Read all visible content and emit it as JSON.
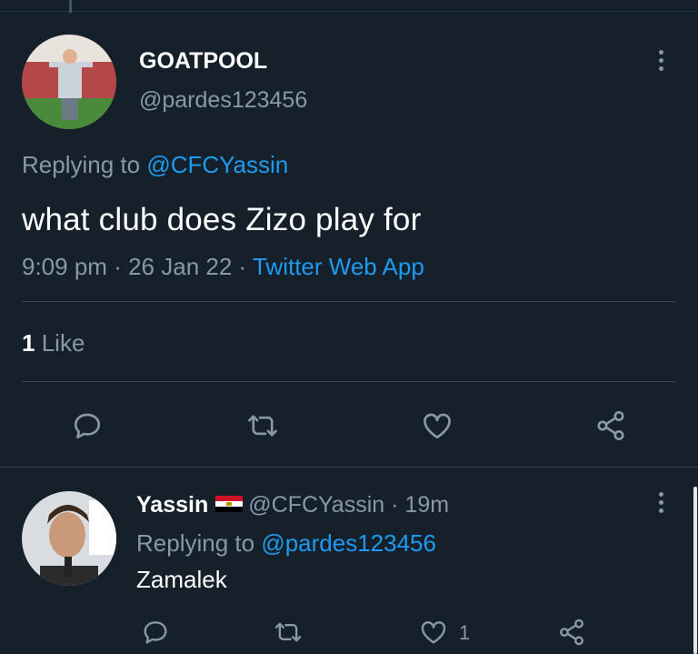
{
  "main_tweet": {
    "display_name": "GOATPOOL",
    "handle": "@pardes123456",
    "replying_prefix": "Replying to",
    "replying_to": "@CFCYassin",
    "text": "what club does Zizo play for",
    "time": "9:09 pm",
    "date": "26 Jan 22",
    "source": "Twitter Web App",
    "likes_count": "1",
    "likes_label": "Like"
  },
  "reply_tweet": {
    "display_name": "Yassin",
    "handle": "@CFCYassin",
    "age": "19m",
    "replying_prefix": "Replying to",
    "replying_to": "@pardes123456",
    "text": "Zamalek",
    "like_count": "1"
  },
  "separator": "·",
  "icons": {
    "more": "more-dots-icon",
    "reply": "reply-icon",
    "retweet": "retweet-icon",
    "like": "heart-icon",
    "share": "share-icon",
    "flag": "egypt-flag-icon"
  },
  "colors": {
    "background": "#15202b",
    "link": "#1d9bf0",
    "secondary_text": "#8899a6",
    "divider": "#38444d"
  }
}
